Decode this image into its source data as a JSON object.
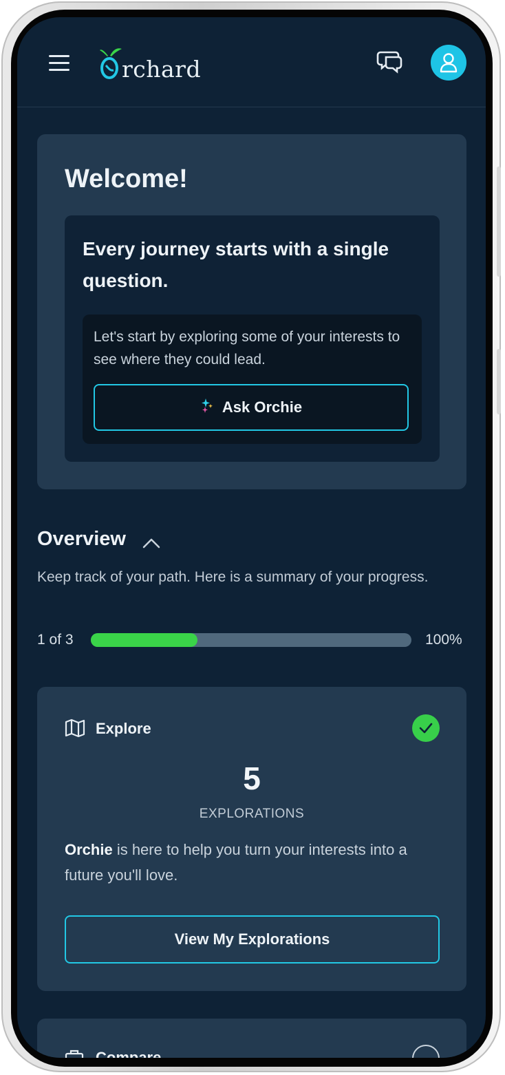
{
  "app": {
    "logo_text": "rchard"
  },
  "welcome": {
    "title": "Welcome!",
    "journey_text": "Every journey starts with a single question.",
    "prompt_text": "Let's start by exploring some of your interests to see where they could lead.",
    "ask_button": "Ask Orchie"
  },
  "overview": {
    "title": "Overview",
    "description": "Keep track of your path. Here is a summary of your progress.",
    "progress_label": "1 of 3",
    "progress_fraction": 0.333,
    "progress_percent_text": "100%"
  },
  "explore": {
    "title": "Explore",
    "count": "5",
    "count_label": "EXPLORATIONS",
    "desc_bold": "Orchie",
    "desc_rest": " is here to help you turn your interests into a future you'll love.",
    "button": "View My Explorations",
    "completed": true
  },
  "compare": {
    "title": "Compare"
  },
  "colors": {
    "accent": "#22c8e5",
    "success": "#3ad449",
    "background": "#0e2236",
    "card": "#233a50"
  },
  "icons": [
    "menu-icon",
    "orchard-logo",
    "chat-icon",
    "user-icon",
    "sparkle-icon",
    "chevron-up-icon",
    "map-icon",
    "check-icon",
    "briefcase-icon"
  ]
}
